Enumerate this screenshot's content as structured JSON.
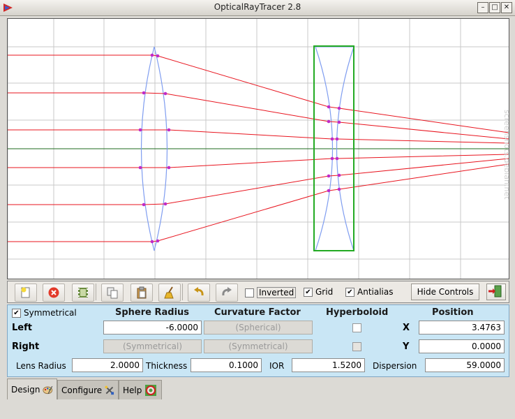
{
  "window": {
    "title": "OpticalRayTracer 2.8",
    "controls": [
      "minimize",
      "maximize",
      "close"
    ]
  },
  "canvas": {
    "colors": {
      "grid": "#c8c8c8",
      "axis": "#1d6a1d",
      "ray": "#e8141e",
      "lens": "#7f9df0",
      "intersection": "#c02ac8",
      "selection": "#22aa22"
    },
    "watermark": "screenshots.debian.net"
  },
  "toolbar": {
    "buttons": [
      {
        "name": "new-lens-button",
        "icon": "new-lens-icon"
      },
      {
        "name": "delete-button",
        "icon": "delete-icon"
      },
      {
        "name": "film-button",
        "icon": "film-icon"
      },
      {
        "name": "copy-button",
        "icon": "copy-icon"
      },
      {
        "name": "paste-button",
        "icon": "paste-icon"
      },
      {
        "name": "clean-button",
        "icon": "broom-icon"
      },
      {
        "name": "undo-button",
        "icon": "undo-icon"
      },
      {
        "name": "redo-button",
        "icon": "redo-icon"
      }
    ],
    "inverted": {
      "label": "Inverted",
      "checked": false
    },
    "grid": {
      "label": "Grid",
      "checked": true
    },
    "antialias": {
      "label": "Antialias",
      "checked": true
    },
    "hide_controls": "Hide Controls",
    "exit_icon": "exit-icon"
  },
  "lens_panel": {
    "symmetrical": {
      "label": "Symmetrical",
      "checked": true
    },
    "headers": {
      "sphere_radius": "Sphere Radius",
      "curvature_factor": "Curvature Factor",
      "hyperboloid": "Hyperboloid",
      "position": "Position"
    },
    "left": {
      "label": "Left",
      "sphere_radius": "-6.0000",
      "curvature_factor": "(Spherical)",
      "hyperboloid": false
    },
    "right": {
      "label": "Right",
      "sphere_radius": "(Symmetrical)",
      "curvature_factor": "(Symmetrical)",
      "hyperboloid": false
    },
    "position": {
      "x_label": "X",
      "x": "3.4763",
      "y_label": "Y",
      "y": "0.0000"
    },
    "lens_radius": {
      "label": "Lens Radius",
      "value": "2.0000"
    },
    "thickness": {
      "label": "Thickness",
      "value": "0.1000"
    },
    "ior": {
      "label": "IOR",
      "value": "1.5200"
    },
    "dispersion": {
      "label": "Dispersion",
      "value": "59.0000"
    }
  },
  "tabs": [
    {
      "label": "Design",
      "active": true,
      "icon": "palette-icon"
    },
    {
      "label": "Configure",
      "active": false,
      "icon": "tools-icon"
    },
    {
      "label": "Help",
      "active": false,
      "icon": "lifebuoy-icon"
    }
  ]
}
